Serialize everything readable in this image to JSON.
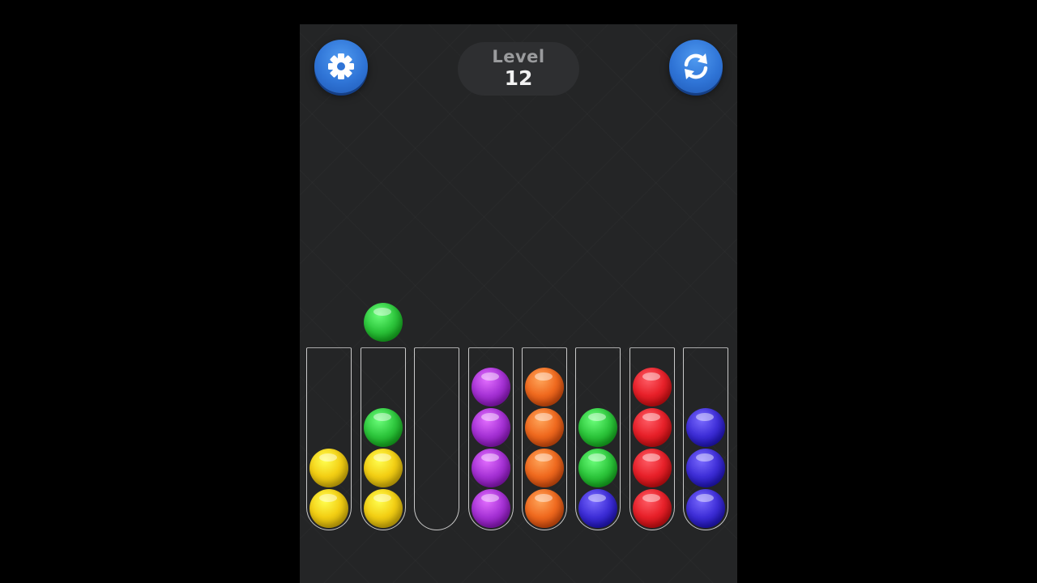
{
  "header": {
    "level_label": "Level",
    "level_number": "12",
    "settings_icon": "gear-icon",
    "restart_icon": "restart-icon"
  },
  "colors": {
    "button_blue": "#2f74d6",
    "yellow": "#f3cf14",
    "green": "#2fc83e",
    "purple": "#a733d6",
    "orange": "#f06a1f",
    "blue": "#3f2fd8",
    "red": "#e8212a"
  },
  "lifted_ball": {
    "tube": 2,
    "color": "green"
  },
  "tubes": [
    {
      "balls": [
        "yellow",
        "yellow"
      ]
    },
    {
      "balls": [
        "yellow",
        "yellow",
        "green"
      ]
    },
    {
      "balls": []
    },
    {
      "balls": [
        "purple",
        "purple",
        "purple",
        "purple"
      ]
    },
    {
      "balls": [
        "orange",
        "orange",
        "orange",
        "orange"
      ]
    },
    {
      "balls": [
        "blue",
        "green",
        "green"
      ]
    },
    {
      "balls": [
        "red",
        "red",
        "red",
        "red"
      ]
    },
    {
      "balls": [
        "blue",
        "blue",
        "blue"
      ]
    }
  ]
}
